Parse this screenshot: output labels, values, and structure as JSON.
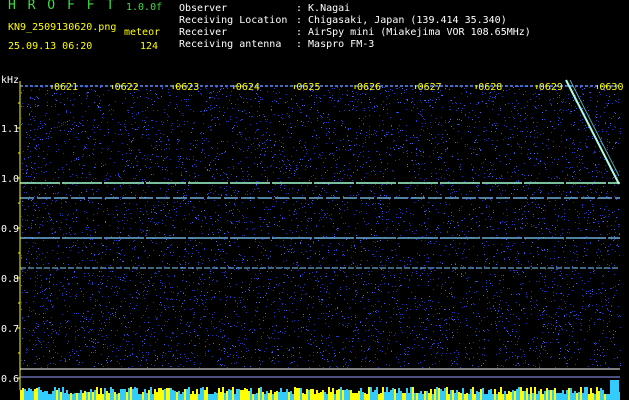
{
  "app": {
    "title_letters": "H R O F F T",
    "version": "1.0.0f",
    "filename": "KN9_2509130620.png",
    "mode": "meteor",
    "datetime": "25.09.13 06:20",
    "count": "124"
  },
  "info": {
    "observer_label": "Observer",
    "observer_value": ": K.Nagai",
    "location_label": "Receiving Location",
    "location_value": ": Chigasaki, Japan (139.414 35.340)",
    "receiver_label": "Receiver",
    "receiver_value": ": AirSpy mini (Miakejima VOR 108.65MHz)",
    "antenna_label": "Receiving antenna",
    "antenna_value": ": Maspro FM-3"
  },
  "axis": {
    "unit": "kHz",
    "y_ticks": [
      "1.1",
      "1.0",
      "0.9",
      "0.8",
      "0.7",
      "0.6"
    ],
    "time_ticks": [
      "0621",
      "0622",
      "0623",
      "0624",
      "0625",
      "0626",
      "0627",
      "0628",
      "0629",
      "0630"
    ]
  },
  "colors": {
    "background": "#000000",
    "noise": "#1a3acc",
    "carrier": "#7fd0ff",
    "header_accent": "#3fdc3f",
    "label": "#ffff00"
  },
  "carriers_khz": [
    0.99,
    0.96,
    0.88,
    0.82
  ]
}
